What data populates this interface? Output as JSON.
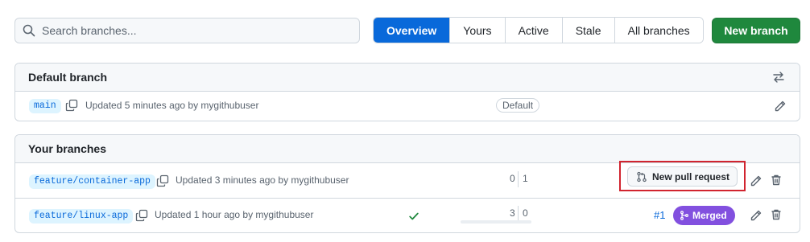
{
  "search": {
    "placeholder": "Search branches..."
  },
  "tabs": [
    {
      "label": "Overview",
      "active": true
    },
    {
      "label": "Yours",
      "active": false
    },
    {
      "label": "Active",
      "active": false
    },
    {
      "label": "Stale",
      "active": false
    },
    {
      "label": "All branches",
      "active": false
    }
  ],
  "new_branch_label": "New branch",
  "default_section": {
    "title": "Default branch",
    "branch": {
      "name": "main",
      "updated": "Updated 5 minutes ago by mygithubuser",
      "badge": "Default"
    }
  },
  "your_section": {
    "title": "Your branches",
    "branches": [
      {
        "name": "feature/container-app",
        "updated": "Updated 3 minutes ago by mygithubuser",
        "behind": "0",
        "ahead": "1",
        "action_label": "New pull request"
      },
      {
        "name": "feature/linux-app",
        "updated": "Updated 1 hour ago by mygithubuser",
        "behind": "3",
        "ahead": "0",
        "pr_number": "#1",
        "pr_status": "Merged",
        "check": "success"
      }
    ]
  },
  "colors": {
    "primary": "#0969da",
    "success": "#1f883d",
    "merged": "#8250df",
    "highlight": "#d1242f"
  }
}
